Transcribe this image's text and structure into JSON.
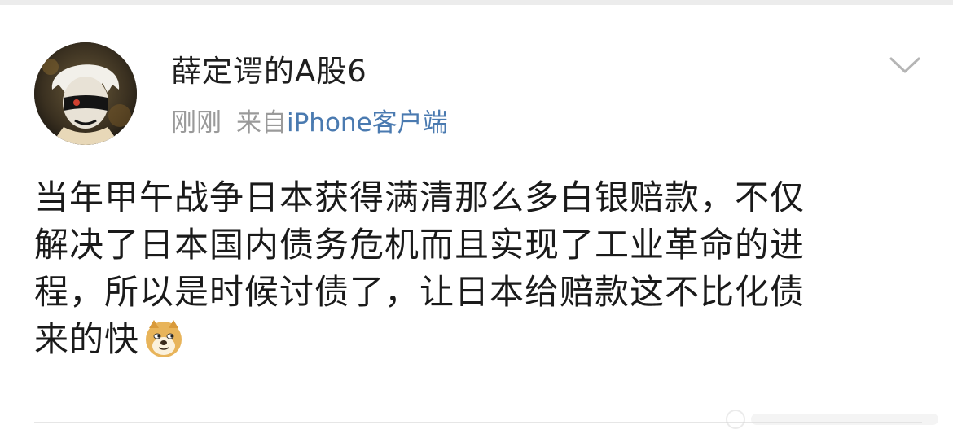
{
  "post": {
    "username": "薛定谔的A股6",
    "time": "刚刚",
    "source_prefix": "来自",
    "source_device": "iPhone客户端",
    "content_lines": [
      "当年甲午战争日本获得满清那么多白银赔款，不仅",
      "解决了日本国内债务危机而且实现了工业革命的进",
      "程，所以是时候讨债了，让日本给赔款这不比化债",
      "来的快"
    ],
    "emoji": "doge-emoji"
  },
  "icons": {
    "menu": "chevron-down-icon",
    "avatar": "avatar"
  },
  "colors": {
    "link": "#4a7ab0",
    "meta": "#9a9a9a",
    "text": "#1a1a1a"
  }
}
